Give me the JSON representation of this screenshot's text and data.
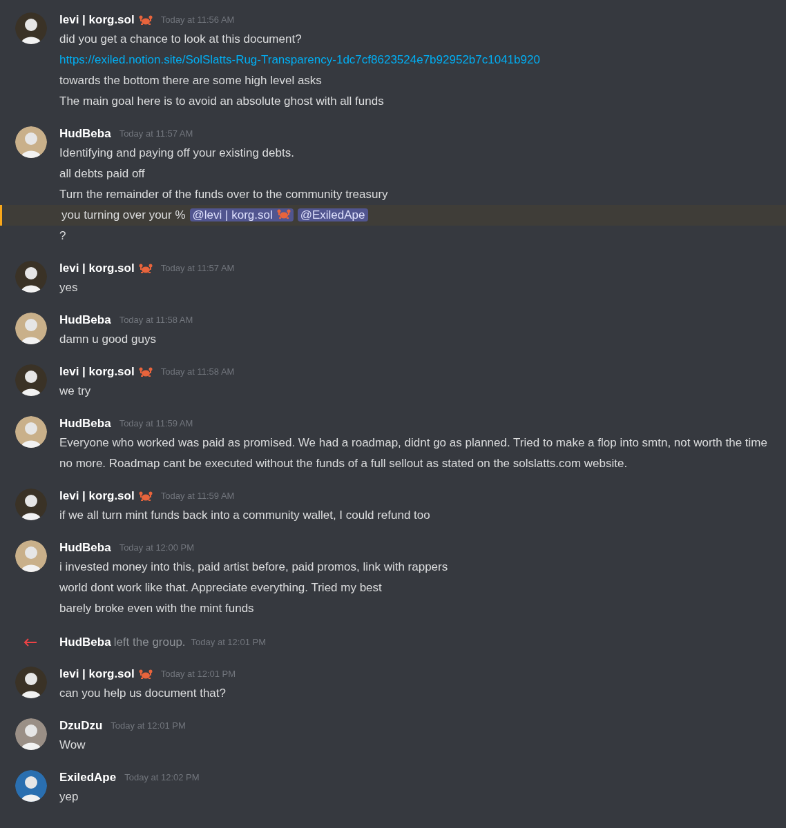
{
  "messages": [
    {
      "kind": "group",
      "author": "levi | korg.sol",
      "crab": true,
      "color": "#3a3226",
      "time": "Today at 11:56 AM",
      "lines": [
        {
          "kind": "text",
          "text": "did you get a chance to look at this document?",
          "highlighted": false
        },
        {
          "kind": "link",
          "text": "https://exiled.notion.site/SolSlatts-Rug-Transparency-1dc7cf8623524e7b92952b7c1041b920",
          "highlighted": false
        },
        {
          "kind": "text",
          "text": "towards the bottom there are some high level asks",
          "highlighted": false
        },
        {
          "kind": "text",
          "text": "The main goal here is to avoid an absolute ghost with all funds",
          "highlighted": false
        }
      ]
    },
    {
      "kind": "group",
      "author": "HudBeba",
      "crab": false,
      "color": "#c9b08a",
      "time": "Today at 11:57 AM",
      "lines": [
        {
          "kind": "text",
          "text": "Identifying and paying off your existing debts.",
          "highlighted": false
        },
        {
          "kind": "text",
          "text": "all debts paid off",
          "highlighted": false
        },
        {
          "kind": "text",
          "text": "Turn the remainder of the funds over to the community treasury",
          "highlighted": false
        },
        {
          "kind": "mention",
          "text": "you turning over your %",
          "mentions": [
            {
              "text": "@levi | korg.sol",
              "crab": true
            },
            {
              "text": "@ExiledApe",
              "crab": false
            }
          ],
          "highlighted": true
        },
        {
          "kind": "text",
          "text": "?",
          "highlighted": false
        }
      ]
    },
    {
      "kind": "group",
      "author": "levi | korg.sol",
      "crab": true,
      "color": "#3a3226",
      "time": "Today at 11:57 AM",
      "lines": [
        {
          "kind": "text",
          "text": "yes",
          "highlighted": false
        }
      ]
    },
    {
      "kind": "group",
      "author": "HudBeba",
      "crab": false,
      "color": "#c9b08a",
      "time": "Today at 11:58 AM",
      "lines": [
        {
          "kind": "text",
          "text": "damn u good guys",
          "highlighted": false
        }
      ]
    },
    {
      "kind": "group",
      "author": "levi | korg.sol",
      "crab": true,
      "color": "#3a3226",
      "time": "Today at 11:58 AM",
      "lines": [
        {
          "kind": "text",
          "text": "we try",
          "highlighted": false
        }
      ]
    },
    {
      "kind": "group",
      "author": "HudBeba",
      "crab": false,
      "color": "#c9b08a",
      "time": "Today at 11:59 AM",
      "lines": [
        {
          "kind": "text",
          "text": "Everyone who worked was paid as promised. We had a roadmap, didnt go as planned. Tried to make a flop into smtn, not worth the time no more. Roadmap cant be executed without the funds of a full sellout as stated on the solslatts.com website.",
          "highlighted": false
        }
      ]
    },
    {
      "kind": "group",
      "author": "levi | korg.sol",
      "crab": true,
      "color": "#3a3226",
      "time": "Today at 11:59 AM",
      "lines": [
        {
          "kind": "text",
          "text": "if we all turn mint funds back into a community wallet, I could refund too",
          "highlighted": false
        }
      ]
    },
    {
      "kind": "group",
      "author": "HudBeba",
      "crab": false,
      "color": "#c9b08a",
      "time": "Today at 12:00 PM",
      "lines": [
        {
          "kind": "text",
          "text": "i invested money into this, paid artist before, paid promos, link with rappers",
          "highlighted": false
        },
        {
          "kind": "text",
          "text": "world dont work like that. Appreciate everything. Tried my best",
          "highlighted": false
        },
        {
          "kind": "text",
          "text": "barely broke even with the mint funds",
          "highlighted": false
        }
      ]
    },
    {
      "kind": "leave",
      "author": "HudBeba",
      "text": "left the group.",
      "time": "Today at 12:01 PM"
    },
    {
      "kind": "group",
      "author": "levi | korg.sol",
      "crab": true,
      "color": "#3a3226",
      "time": "Today at 12:01 PM",
      "lines": [
        {
          "kind": "text",
          "text": "can you help us document that?",
          "highlighted": false
        }
      ]
    },
    {
      "kind": "group",
      "author": "DzuDzu",
      "crab": false,
      "color": "#9a8f86",
      "time": "Today at 12:01 PM",
      "lines": [
        {
          "kind": "text",
          "text": "Wow",
          "highlighted": false
        }
      ]
    },
    {
      "kind": "group",
      "author": "ExiledApe",
      "crab": false,
      "color": "#2a6fb0",
      "time": "Today at 12:02 PM",
      "lines": [
        {
          "kind": "text",
          "text": "yep",
          "highlighted": false
        }
      ]
    }
  ]
}
